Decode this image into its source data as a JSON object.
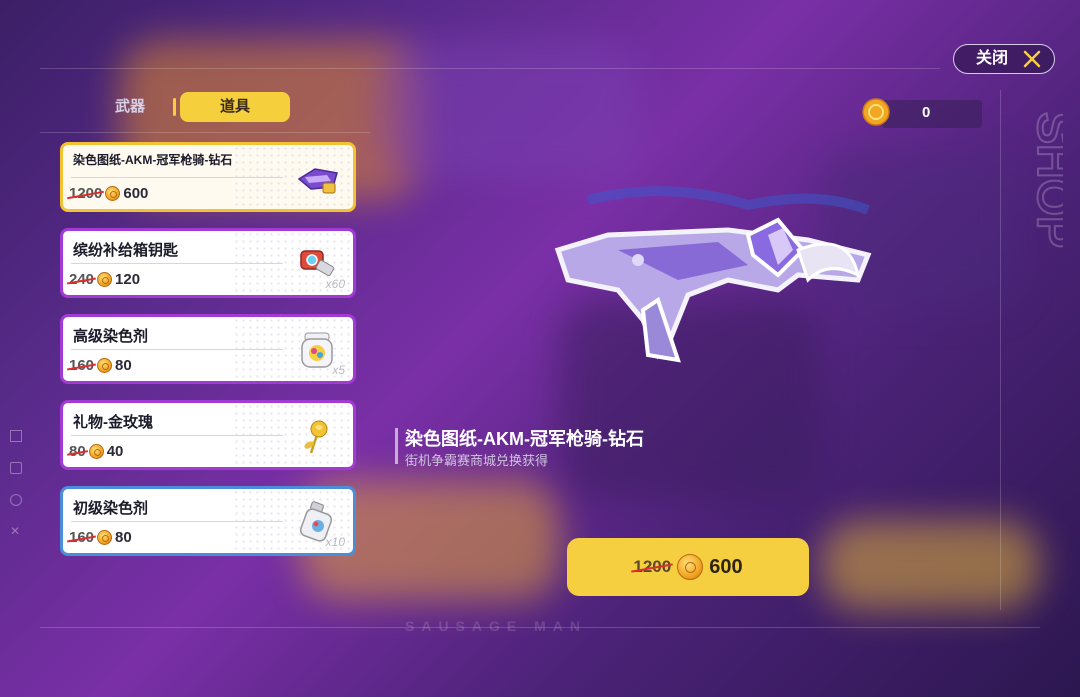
{
  "tabs": [
    {
      "label": "武器",
      "active": false
    },
    {
      "label": "道具",
      "active": true
    }
  ],
  "close_label": "关闭",
  "currency": {
    "value": "0",
    "icon": "coin-icon"
  },
  "shop_label": "SHOP",
  "items": [
    {
      "name": "染色图纸-AKM-冠军枪骑-钻石",
      "old_price": "1200",
      "price": "600",
      "qty": "",
      "icon": "weapon-blueprint-icon"
    },
    {
      "name": "缤纷补给箱钥匙",
      "old_price": "240",
      "price": "120",
      "qty": "x60",
      "icon": "key-icon"
    },
    {
      "name": "高级染色剂",
      "old_price": "160",
      "price": "80",
      "qty": "x5",
      "icon": "dye-jar-icon"
    },
    {
      "name": "礼物-金玫瑰",
      "old_price": "80",
      "price": "40",
      "qty": "",
      "icon": "gold-rose-icon"
    },
    {
      "name": "初级染色剂",
      "old_price": "160",
      "price": "80",
      "qty": "x10",
      "icon": "dye-bottle-icon"
    }
  ],
  "detail": {
    "title": "染色图纸-AKM-冠军枪骑-钻石",
    "subtitle": "街机争霸赛商城兑换获得"
  },
  "buy": {
    "old_price": "1200",
    "price": "600"
  },
  "footer": "SAUSAGE MAN",
  "colors": {
    "accent": "#f5cf3f",
    "item_border": "#a43ad4",
    "selected_border": "#f2c233",
    "blue_border": "#4a8ed8"
  }
}
